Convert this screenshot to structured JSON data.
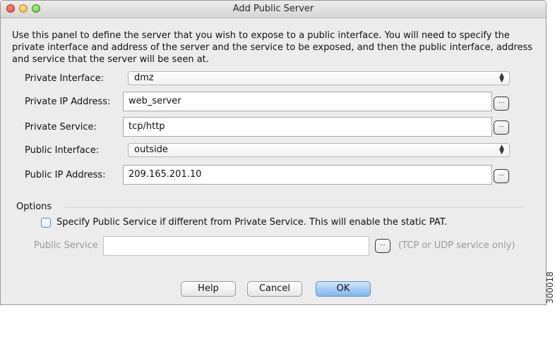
{
  "window": {
    "title": "Add Public Server"
  },
  "description": "Use this panel to define the server that you wish to expose to a public interface. You will need to specify the private interface and address of the server and the service to be exposed, and then the public interface, address and service that the server will be seen at.",
  "form": {
    "private_interface": {
      "label": "Private Interface:",
      "value": "dmz"
    },
    "private_ip": {
      "label": "Private IP Address:",
      "value": "web_server"
    },
    "private_service": {
      "label": "Private Service:",
      "value": "tcp/http"
    },
    "public_interface": {
      "label": "Public Interface:",
      "value": "outside"
    },
    "public_ip": {
      "label": "Public IP Address:",
      "value": "209.165.201.10"
    },
    "browse_glyph": "...",
    "select_arrows_up": "▲",
    "select_arrows_down": "▼"
  },
  "options": {
    "heading": "Options",
    "checkbox_label": "Specify Public Service if different from Private Service.  This will enable the static PAT.",
    "checkbox_checked": false,
    "public_service_label": "Public Service",
    "public_service_value": "",
    "public_service_hint": "(TCP or UDP service only)"
  },
  "buttons": {
    "help": "Help",
    "cancel": "Cancel",
    "ok": "OK"
  },
  "figure_code": "300018",
  "colors": {
    "window_bg": "#ececec",
    "checkbox_border": "#4b8fd9",
    "default_button": "#7fb7ee",
    "disabled_text": "#9a9a9a"
  }
}
